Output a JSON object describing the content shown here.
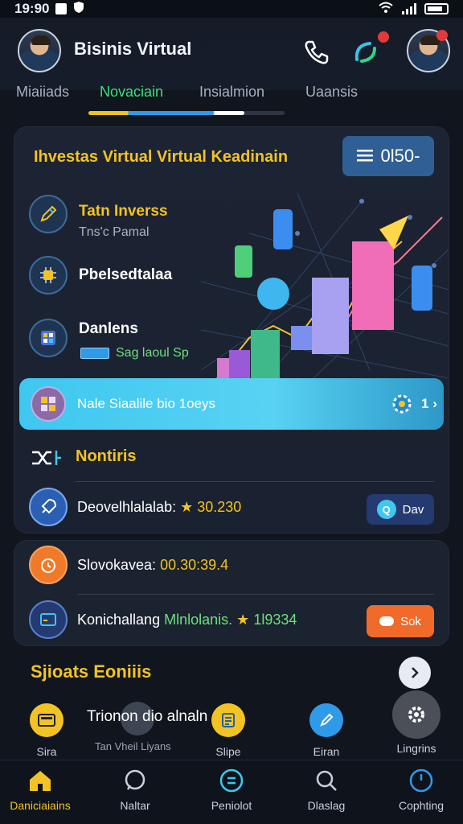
{
  "status": {
    "time": "19:90"
  },
  "header": {
    "title": "Bisinis Virtual"
  },
  "tabs": [
    {
      "label": "Miaiiads",
      "active": false
    },
    {
      "label": "Novaciain",
      "active": true
    },
    {
      "label": "Insialmion",
      "active": false
    },
    {
      "label": "Uaansis",
      "active": false
    }
  ],
  "card": {
    "title": "Ihvestas Virtual Virtual Keadinain",
    "balance": "0l50-",
    "rows": [
      {
        "title": "Tatn Inverss",
        "sub": "Tns'c Pamal",
        "icon": "pen-icon"
      },
      {
        "title": "Pbelsedtalaa",
        "sub": "",
        "icon": "chip-icon"
      },
      {
        "title": "Danlens",
        "sub": "Sag laoul Sp",
        "icon": "calculator-icon"
      }
    ],
    "banner": {
      "text": "Nale Siaalile bio 1oeys",
      "count": "1"
    },
    "section_title": "Nontiris",
    "list_row": {
      "label": "Deovelhlalalab:",
      "value": "30.230",
      "button": "Dav"
    }
  },
  "card2": {
    "row1": {
      "label": "Slovokavea:",
      "value": "00.30:39.4"
    },
    "row2": {
      "label": "Konichallang",
      "label2": "Mlnlolanis.",
      "value": "1l9334",
      "button": "Sok"
    }
  },
  "section2": {
    "title": "Sjioats Eoniiis"
  },
  "quick": {
    "items": [
      {
        "label": "Sira"
      },
      {
        "label": "Slipe"
      },
      {
        "label": "Eiran"
      },
      {
        "label": "Lingrins"
      }
    ],
    "mid_text": "Trionon dio alnaln",
    "mid_sub": "Tan Vheil Liyans"
  },
  "nav": [
    {
      "label": "Daniciaiains",
      "active": true
    },
    {
      "label": "Naltar",
      "active": false
    },
    {
      "label": "Peniolot",
      "active": false
    },
    {
      "label": "Dlaslag",
      "active": false
    },
    {
      "label": "Cophting",
      "active": false
    }
  ],
  "colors": {
    "accent_yellow": "#f3c324",
    "accent_green": "#3ee07a",
    "accent_blue": "#2f9ae8",
    "warn_orange": "#f07a2a"
  }
}
